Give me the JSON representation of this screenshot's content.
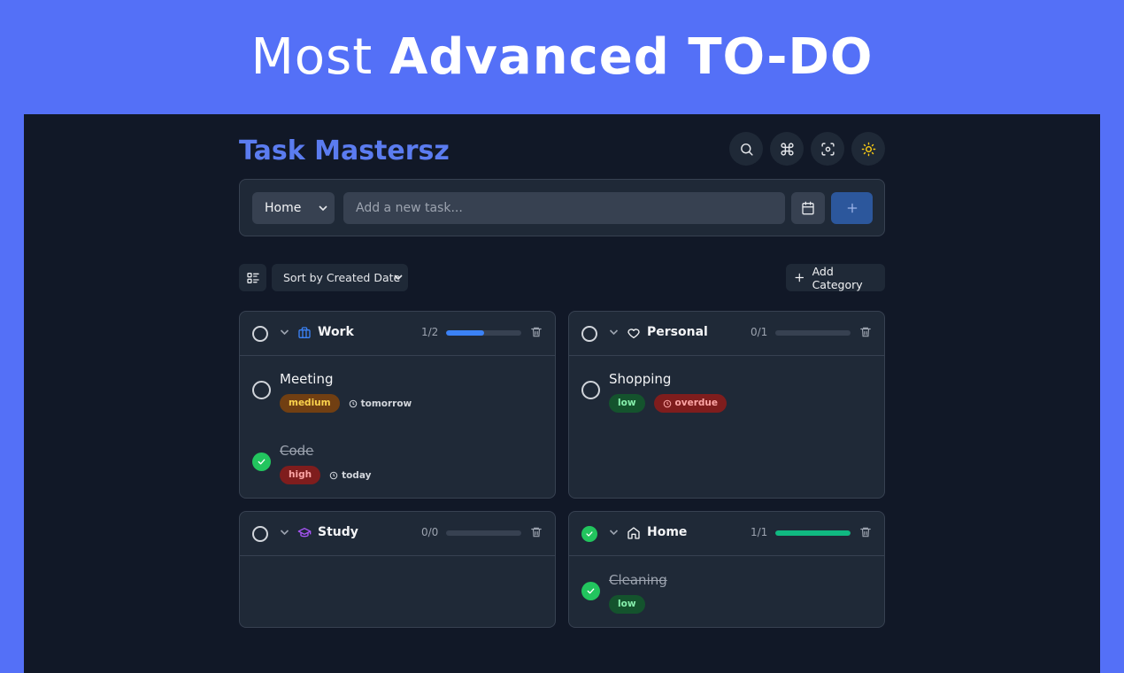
{
  "banner": {
    "title_light": "Most",
    "title_bold": "Advanced TO-DO"
  },
  "app": {
    "title": "Task Mastersz",
    "header_actions": [
      "search-icon",
      "command-icon",
      "focus-icon",
      "sun-icon"
    ]
  },
  "add_task": {
    "category_value": "Home",
    "placeholder": "Add a new task...",
    "calendar_icon": "calendar-icon",
    "add_icon": "plus-icon"
  },
  "toolbar": {
    "view_icon": "list-view-icon",
    "sort_value": "Sort by Created Date",
    "add_category_label": "Add Category"
  },
  "categories": [
    {
      "name": "Work",
      "icon": "briefcase-icon",
      "count": "1/2",
      "progress": 0.5,
      "color": "#3b82f6",
      "completed": false,
      "tasks": [
        {
          "name": "Meeting",
          "priority": "medium",
          "due": "tomorrow",
          "done": false
        },
        {
          "name": "Code",
          "priority": "high",
          "due": "today",
          "done": true
        }
      ]
    },
    {
      "name": "Personal",
      "icon": "heart-icon",
      "count": "0/1",
      "progress": 0,
      "color": "#3b82f6",
      "completed": false,
      "tasks": [
        {
          "name": "Shopping",
          "priority": "low",
          "due": "overdue",
          "done": false
        }
      ]
    },
    {
      "name": "Study",
      "icon": "graduation-cap-icon",
      "count": "0/0",
      "progress": 0,
      "color": "#a855f7",
      "completed": false,
      "tasks": []
    },
    {
      "name": "Home",
      "icon": "house-icon",
      "count": "1/1",
      "progress": 1,
      "color": "#10b981",
      "completed": true,
      "tasks": [
        {
          "name": "Cleaning",
          "priority": "low",
          "done": true
        }
      ]
    }
  ],
  "colors": {
    "banner": "#5470f7",
    "background": "#111827",
    "panel": "#1f2937",
    "accent": "#5b7cf0",
    "done": "#22c55e"
  }
}
